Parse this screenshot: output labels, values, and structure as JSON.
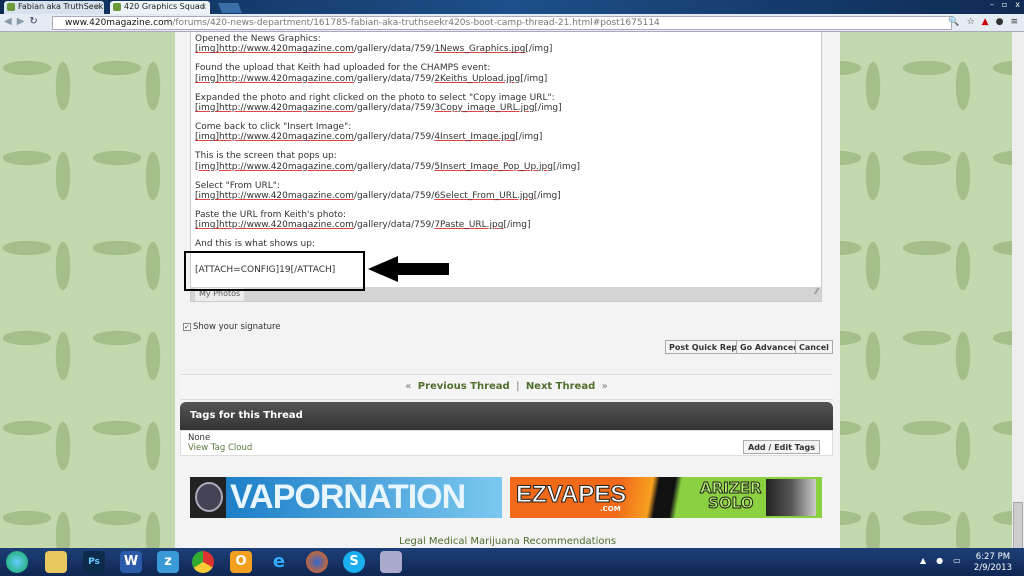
{
  "browser": {
    "tabs": [
      {
        "label": "Fabian aka TruthSeek"
      },
      {
        "label": "420 Graphics Squad"
      }
    ],
    "url_domain": "www.420magazine.com",
    "url_path": "/forums/420-news-department/161785-fabian-aka-truthseekr420s-boot-camp-thread-21.html#post1675114"
  },
  "editor": {
    "lines": [
      {
        "label": "Opened the News Graphics:",
        "pre": " [img]http://",
        "link": "www.420magazine.com",
        "mid": "/gallery/data/759/",
        "file": "1News_Graphics.jpg",
        "post": "[/img]"
      },
      {
        "label": "Found the upload that Keith had uploaded for the CHAMPS event:",
        "pre": " [img]http://",
        "link": "www.420magazine.com",
        "mid": "/gallery/data/759/",
        "file": "2Keiths_Upload.jpg",
        "post": "[/img]"
      },
      {
        "label": "Expanded the photo and right clicked on the photo to select \"Copy image URL\":",
        "pre": "[img]http://",
        "link": "www.420magazine.com",
        "mid": "/gallery/data/759/",
        "file": "3Copy_image_URL.jpg",
        "post": "[/img]"
      },
      {
        "label": "Come back to click \"Insert Image\":",
        "pre": "[img]http://",
        "link": "www.420magazine.com",
        "mid": "/gallery/data/759/",
        "file": "4Insert_Image.jpg",
        "post": "[/img]"
      },
      {
        "label": "This is the screen that pops up:",
        "pre": "[img]http://",
        "link": "www.420magazine.com",
        "mid": "/gallery/data/759/",
        "file": "5Insert_Image_Pop_Up.jpg",
        "post": "[/img]"
      },
      {
        "label": "Select \"From URL\":",
        "pre": "[img]http://",
        "link": "www.420magazine.com",
        "mid": "/gallery/data/759/",
        "file": "6Select_From_URL.jpg",
        "post": "[/img]"
      },
      {
        "label": "Paste the URL from Keith's photo:",
        "pre": "[img]http://",
        "link": "www.420magazine.com",
        "mid": "/gallery/data/759/",
        "file": "7Paste_URL.jpg",
        "post": "[/img]"
      }
    ],
    "last_line": "And this is what shows up:",
    "attach": "[ATTACH=CONFIG]19[/ATTACH]",
    "my_photos": "My Photos"
  },
  "signature_label": "Show your signature",
  "signature_checked": true,
  "buttons": {
    "post": "Post Quick Reply",
    "advanced": "Go Advanced",
    "cancel": "Cancel"
  },
  "thread_nav": {
    "prev_arrow": "«",
    "prev": "Previous Thread",
    "sep": "|",
    "next": "Next Thread",
    "next_arrow": "»"
  },
  "tags": {
    "title": "Tags for this Thread",
    "value": "None",
    "cloud": "View Tag Cloud",
    "edit": "Add / Edit Tags"
  },
  "ads": {
    "ad1": "VAPORNATION",
    "ad2": "EZVAPES",
    "ad2_sub": ".COM",
    "ad2_product1": "ARIZER",
    "ad2_product2": "SOLO"
  },
  "footer_link": "Legal Medical Marijuana Recommendations",
  "taskbar": {
    "time": "6:27 PM",
    "date": "2/9/2013"
  },
  "colors": {
    "link_green": "#4f6f2e",
    "taskbar": "#1c3f78"
  }
}
